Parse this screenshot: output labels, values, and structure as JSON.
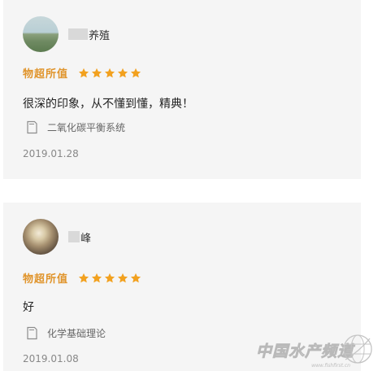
{
  "reviews": [
    {
      "username_visible": "养殖",
      "rating_label": "物超所值",
      "stars": 5,
      "comment": "很深的印象，从不懂到懂，精典！",
      "book_title": "二氧化碳平衡系统",
      "date": "2019.01.28"
    },
    {
      "username_visible": "峰",
      "rating_label": "物超所值",
      "stars": 5,
      "comment": "好",
      "book_title": "化学基础理论",
      "date": "2019.01.08"
    }
  ],
  "watermark": {
    "text": "中国水产频道",
    "url": "www.fishfirst.cn"
  },
  "colors": {
    "card_background": "#f5f5f5",
    "rating_color": "#e0942b",
    "star_color": "#f2a11f"
  }
}
